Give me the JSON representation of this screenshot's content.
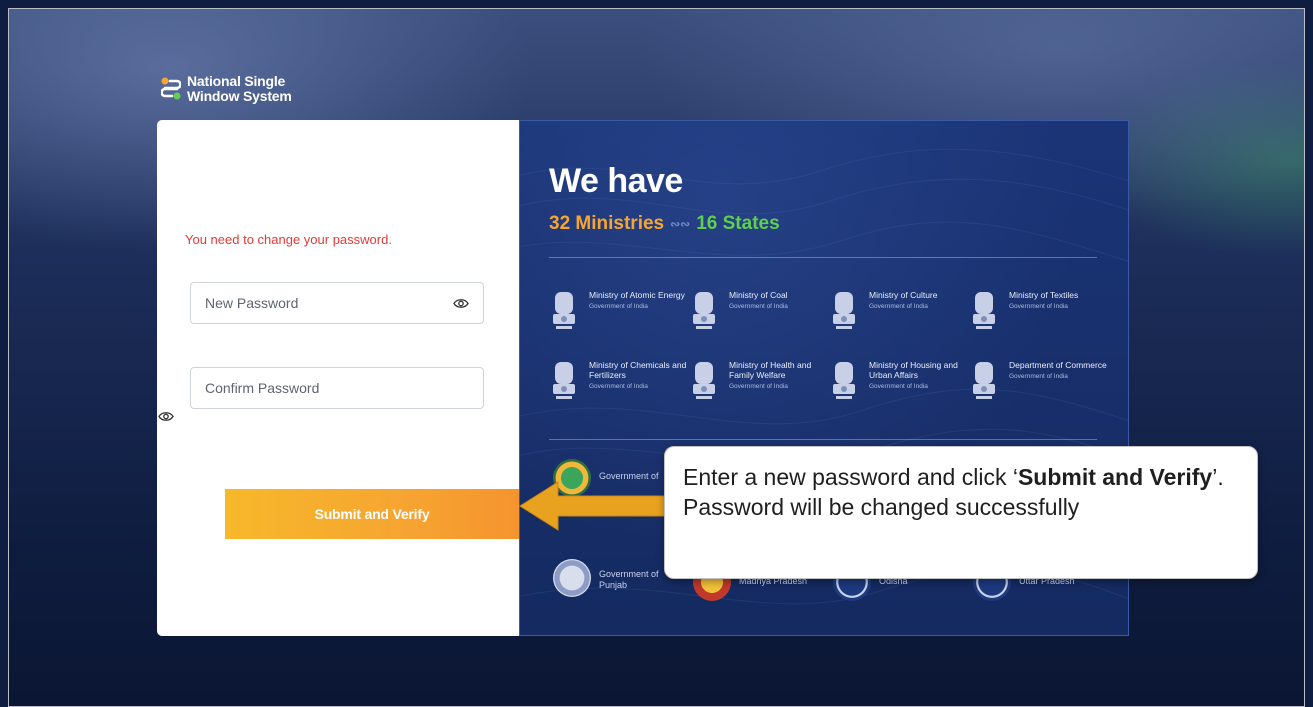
{
  "logo": {
    "line1": "National Single",
    "line2": "Window System"
  },
  "form": {
    "warning": "You need to change your password.",
    "new_password_placeholder": "New Password",
    "confirm_password_placeholder": "Confirm Password",
    "submit_label": "Submit and Verify"
  },
  "info": {
    "heading": "We have",
    "ministries": "32 Ministries",
    "states": "16 States",
    "entities": [
      {
        "name": "Ministry of Atomic Energy",
        "sub": "Government of India"
      },
      {
        "name": "Ministry of Coal",
        "sub": "Government of India"
      },
      {
        "name": "Ministry of Culture",
        "sub": "Government of India"
      },
      {
        "name": "Ministry of Textiles",
        "sub": "Government of India"
      },
      {
        "name": "Ministry of Chemicals and Fertilizers",
        "sub": "Government of India"
      },
      {
        "name": "Ministry of Health and Family Welfare",
        "sub": "Government of India"
      },
      {
        "name": "Ministry of Housing and Urban Affairs",
        "sub": "Government of India"
      },
      {
        "name": "Department of Commerce",
        "sub": "Government of India"
      }
    ],
    "states_list": [
      {
        "name": "Government of"
      },
      {
        "name": "Government of Punjab"
      },
      {
        "name": "Madhya Pradesh"
      },
      {
        "name": "Odisha"
      },
      {
        "name": "Uttar Pradesh"
      }
    ]
  },
  "callout": {
    "pre": "Enter a new password and click ‘",
    "bold": "Submit and Verify",
    "post": "’. Password will be changed successfully"
  },
  "colors": {
    "accent_orange": "#f6a531",
    "accent_green": "#5fcf4d",
    "warning_red": "#e53935",
    "panel_blue": "#172e69",
    "arrow_gold": "#e8a21f"
  }
}
